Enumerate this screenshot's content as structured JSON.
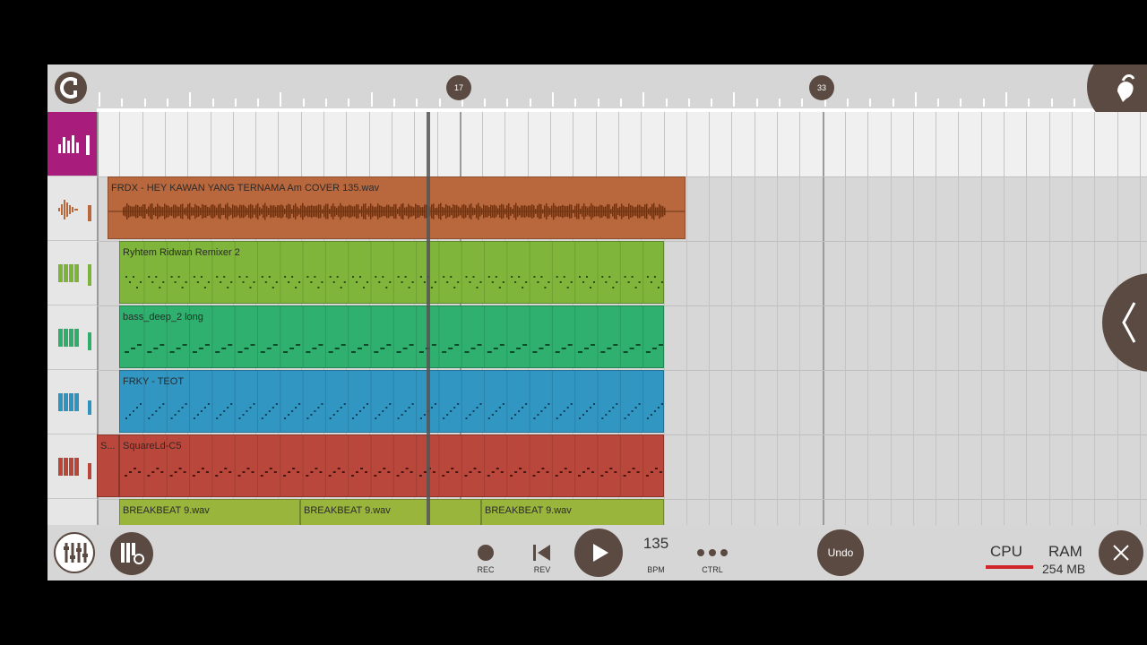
{
  "ruler": {
    "markers": [
      "17",
      "33"
    ]
  },
  "tracks": [
    {
      "kind": "mixer",
      "color": "#a81c7c"
    },
    {
      "kind": "audio",
      "color": "#b8683c"
    },
    {
      "kind": "pattern",
      "color": "#7db33a"
    },
    {
      "kind": "pattern",
      "color": "#2eae6a"
    },
    {
      "kind": "pattern",
      "color": "#2f93c0"
    },
    {
      "kind": "pattern",
      "color": "#b8473a"
    },
    {
      "kind": "audio",
      "color": "#98b33a"
    }
  ],
  "clips": [
    {
      "name": "FRDX - HEY KAWAN YANG TERNAMA Am COVER 135.wav",
      "color": "#b9683e"
    },
    {
      "name": "Ryhtem Ridwan Remixer 2",
      "color": "#7fb53a"
    },
    {
      "name": "bass_deep_2 long",
      "color": "#2fb06e"
    },
    {
      "name": "FRKY - TEOT",
      "color": "#3196c2"
    },
    {
      "name": "S...",
      "color": "#b9473b"
    },
    {
      "name": "SquareLd-C5",
      "color": "#b9473b"
    },
    {
      "name": "BREAKBEAT 9.wav",
      "color": "#9ab53c"
    },
    {
      "name": "BREAKBEAT 9.wav",
      "color": "#9ab53c"
    },
    {
      "name": "BREAKBEAT 9.wav",
      "color": "#9ab53c"
    }
  ],
  "toolbar": {
    "rec_label": "REC",
    "rev_label": "REV",
    "bpm_value": "135",
    "bpm_label": "BPM",
    "ctrl_label": "CTRL",
    "undo_label": "Undo",
    "cpu_label": "CPU",
    "ram_label": "RAM",
    "ram_value": "254 MB",
    "cpu_color": "#d0252b"
  }
}
